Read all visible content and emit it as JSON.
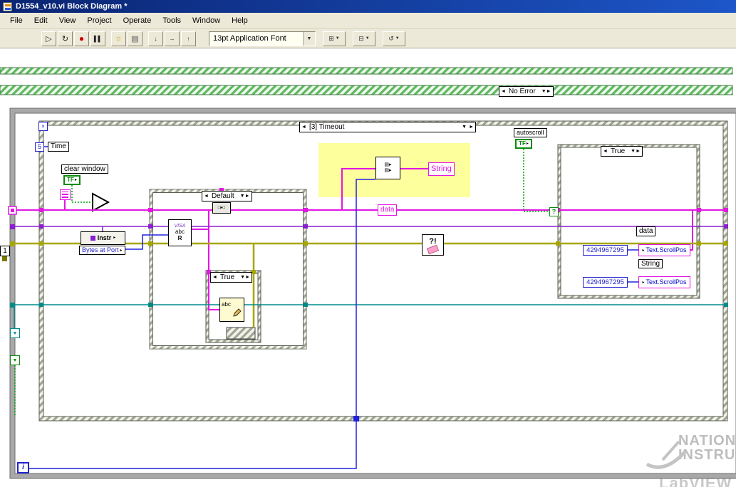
{
  "window": {
    "title": "D1554_v10.vi Block Diagram *",
    "menu": [
      "File",
      "Edit",
      "View",
      "Project",
      "Operate",
      "Tools",
      "Window",
      "Help"
    ],
    "toolbar": {
      "font_selector": "13pt Application Font"
    }
  },
  "icons": {
    "run": "▷",
    "run_continuous": "↻",
    "abort": "●",
    "pause": "▌▌",
    "highlight_execution": "☼",
    "retain_values": "▤",
    "step_into": "↓",
    "step_over": "→",
    "step_out": "↑",
    "dropdown_arrow": "▼",
    "align_objects": "⊞",
    "distribute_objects": "⊟",
    "reorder_objects": "↺",
    "case_prev": "◄",
    "case_next": "►",
    "case_dropdown": "▼",
    "boolean_down": "▼",
    "terminal_arrow": "▸",
    "event_terminal": "×",
    "conversion_glyph": "□▸□",
    "format_glyph1": "▤▸",
    "format_glyph2": "▤▸"
  },
  "structures": {
    "error_case": {
      "selector": "No Error"
    },
    "event_structure": {
      "selector": "[3] Timeout"
    },
    "case_middle": {
      "selector": "Default"
    },
    "case_inner": {
      "selector": "True"
    },
    "case_right": {
      "selector": "True"
    }
  },
  "nodes": {
    "timeout_constant": "5",
    "time_terminal": "Time",
    "clear_window_label": "clear window",
    "clear_window_tf": "TF",
    "autoscroll_label": "autoscroll",
    "autoscroll_tf": "TF",
    "visa_read": {
      "l1": "VISA",
      "l2": "abc",
      "l3": "R"
    },
    "instr_label": "Instr",
    "bytes_at_port": "Bytes at Port",
    "string_label": "String",
    "data_label": "data",
    "abc_node": "abc",
    "clear_errors": "?!",
    "question_terminal": "?",
    "iteration_terminal": "i",
    "one_constant": "1",
    "case_right_data": "data",
    "case_right_string": "String",
    "scrollpos1": "Text.ScrollPos",
    "scrollpos2": "Text.ScrollPos",
    "scroll_const1": "4294967295",
    "scroll_const2": "4294967295"
  },
  "watermark": {
    "l1": "NATIONAL",
    "l2": "INSTRUMENTS",
    "l3": "LabVIEW"
  },
  "colors": {
    "string_wire": "#e316e3",
    "error_wire": "#a6a600",
    "visa_wire": "#8b1fd0",
    "refnum_wire": "#008b8b",
    "numeric_wire": "#2222dd",
    "boolean_wire": "#00a000",
    "highlight_fill": "#fdff9c",
    "titlebar_blue": "#0a2472"
  }
}
